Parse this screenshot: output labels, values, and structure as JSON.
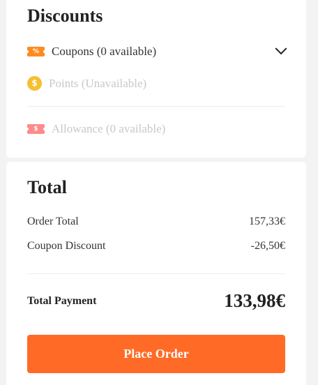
{
  "discounts": {
    "title": "Discounts",
    "coupons": {
      "label": "Coupons (0 available)",
      "icon": "coupon-icon",
      "icon_text": "%"
    },
    "points": {
      "label": "Points (Unavailable)",
      "icon": "coin-icon",
      "icon_text": "$"
    },
    "allowance": {
      "label": "Allowance (0 available)",
      "icon": "allowance-icon",
      "icon_text": "$"
    }
  },
  "total": {
    "title": "Total",
    "order_total_label": "Order Total",
    "order_total_value": "157,33€",
    "coupon_discount_label": "Coupon Discount",
    "coupon_discount_value": "-26,50€",
    "total_payment_label": "Total Payment",
    "total_payment_value": "133,98€"
  },
  "place_order_label": "Place Order",
  "colors": {
    "accent": "#ff6b26",
    "coupon_icon": "#ff8a1f",
    "coin_icon": "#f5c030",
    "allowance_icon": "#ff8a8a",
    "muted_text": "#c8c8c8"
  }
}
